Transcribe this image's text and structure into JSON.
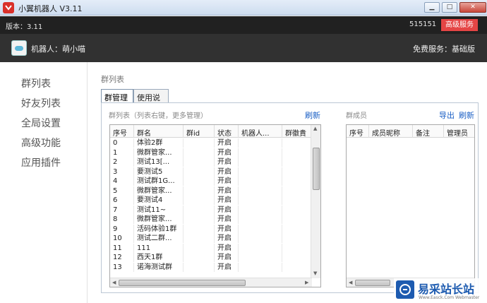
{
  "window": {
    "title": "小翼机器人 V3.11"
  },
  "version_bar": {
    "version": "版本：3.11",
    "number": "515151",
    "vip_button": "高级服务"
  },
  "robot_bar": {
    "robot_name": "机器人：萌小喵",
    "service": "免费服务：基础版"
  },
  "sidebar": {
    "items": [
      {
        "label": "群列表"
      },
      {
        "label": "好友列表"
      },
      {
        "label": "全局设置"
      },
      {
        "label": "高级功能"
      },
      {
        "label": "应用插件"
      }
    ]
  },
  "main": {
    "section_title": "群列表",
    "tabs": [
      {
        "label": "群管理"
      },
      {
        "label": "使用说明"
      }
    ],
    "group_list": {
      "label": "群列表（列表右键，更多管理）",
      "refresh": "刷新",
      "columns": [
        "序号",
        "群名",
        "群id",
        "状态",
        "机器人...",
        "群徽貴"
      ],
      "rows": [
        [
          "0",
          "体验2群",
          "",
          "开启",
          "",
          ""
        ],
        [
          "1",
          "微群管家...",
          "",
          "开启",
          "",
          ""
        ],
        [
          "2",
          "测试13[...",
          "",
          "开启",
          "",
          ""
        ],
        [
          "3",
          "要测试5",
          "",
          "开启",
          "",
          ""
        ],
        [
          "4",
          "测试群1G...",
          "",
          "开启",
          "",
          ""
        ],
        [
          "5",
          "微群管家...",
          "",
          "开启",
          "",
          ""
        ],
        [
          "6",
          "要测试4",
          "",
          "开启",
          "",
          ""
        ],
        [
          "7",
          "测试11~",
          "",
          "开启",
          "",
          ""
        ],
        [
          "8",
          "微群管家...",
          "",
          "开启",
          "",
          ""
        ],
        [
          "9",
          "活码体验1群",
          "",
          "开启",
          "",
          ""
        ],
        [
          "10",
          "测试二群...",
          "",
          "开启",
          "",
          ""
        ],
        [
          "11",
          "111",
          "",
          "开启",
          "",
          ""
        ],
        [
          "12",
          "西天1群",
          "",
          "开启",
          "",
          ""
        ],
        [
          "13",
          "诺海测试群",
          "",
          "开启",
          "",
          ""
        ]
      ]
    },
    "members": {
      "label": "群成员",
      "export": "导出",
      "refresh": "刷新",
      "columns": [
        "序号",
        "成员昵称",
        "备注",
        "管理员"
      ]
    }
  },
  "watermark": {
    "text": "易采站长站",
    "sub": "Www.Easck.Com Webmaster"
  },
  "colors": {
    "accent": "#1a5fc5",
    "vip": "#e54545",
    "dark_bar": "#212121",
    "robot_bar": "#313131"
  }
}
